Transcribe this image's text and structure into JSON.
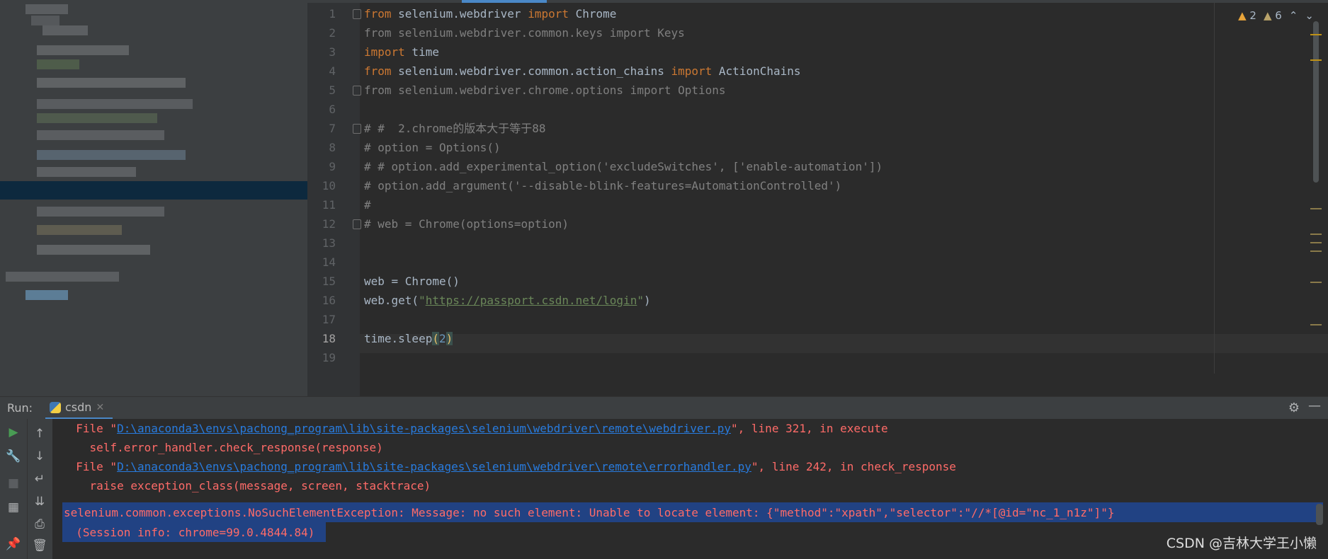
{
  "editor": {
    "lines": [
      {
        "n": "1"
      },
      {
        "n": "2"
      },
      {
        "n": "3"
      },
      {
        "n": "4"
      },
      {
        "n": "5"
      },
      {
        "n": "6"
      },
      {
        "n": "7"
      },
      {
        "n": "8"
      },
      {
        "n": "9"
      },
      {
        "n": "10"
      },
      {
        "n": "11"
      },
      {
        "n": "12"
      },
      {
        "n": "13"
      },
      {
        "n": "14"
      },
      {
        "n": "15"
      },
      {
        "n": "16"
      },
      {
        "n": "17"
      },
      {
        "n": "18"
      },
      {
        "n": "19"
      }
    ],
    "code": {
      "l1_a": "from",
      "l1_b": " selenium.webdriver ",
      "l1_c": "import",
      "l1_d": " Chrome",
      "l2": "from selenium.webdriver.common.keys import Keys",
      "l3_a": "import",
      "l3_b": " time",
      "l4_a": "from",
      "l4_b": " selenium.webdriver.common.action_chains ",
      "l4_c": "import",
      "l4_d": " ActionChains",
      "l5": "from selenium.webdriver.chrome.options import Options",
      "l7": "# #  2.chrome的版本大于等于88",
      "l8": "# option = Options()",
      "l9": "# # option.add_experimental_option('excludeSwitches', ['enable-automation'])",
      "l10": "# option.add_argument('--disable-blink-features=AutomationControlled')",
      "l11": "#",
      "l12": "# web = Chrome(options=option)",
      "l15": "web = Chrome()",
      "l16_a": "web.get(",
      "l16_b": "\"",
      "l16_url": "https://passport.csdn.net/login",
      "l16_c": "\"",
      "l16_d": ")",
      "l18_a": "time.sleep",
      "l18_b": "(",
      "l18_num": "2",
      "l18_c": ")"
    },
    "inspections": {
      "errors": "2",
      "warnings": "6"
    }
  },
  "run": {
    "label": "Run:",
    "tab_name": "csdn",
    "console": {
      "l1_a": "  File \"",
      "l1_link": "D:\\anaconda3\\envs\\pachong_program\\lib\\site-packages\\selenium\\webdriver\\remote\\webdriver.py",
      "l1_b": "\", line 321, in execute",
      "l2": "    self.error_handler.check_response(response)",
      "l3_a": "  File \"",
      "l3_link": "D:\\anaconda3\\envs\\pachong_program\\lib\\site-packages\\selenium\\webdriver\\remote\\errorhandler.py",
      "l3_b": "\", line 242, in check_response",
      "l4": "    raise exception_class(message, screen, stacktrace)",
      "l5": "selenium.common.exceptions.NoSuchElementException: Message: no such element: Unable to locate element: {\"method\":\"xpath\",\"selector\":\"//*[@id=\"nc_1_n1z\"]\"}",
      "l6": "  (Session info: chrome=99.0.4844.84)"
    }
  },
  "watermark": "CSDN @吉林大学王小懒"
}
